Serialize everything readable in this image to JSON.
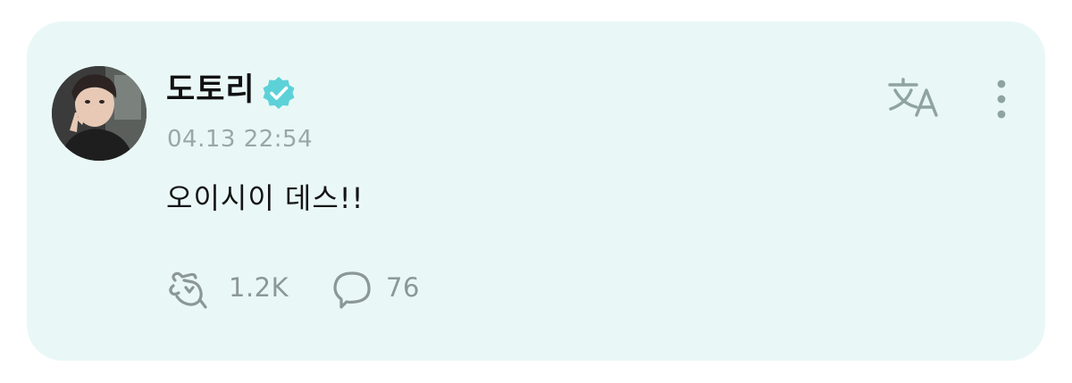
{
  "post": {
    "author": "도토리",
    "timestamp": "04.13 22:54",
    "content": "오이시이 데스!!",
    "likes": "1.2K",
    "comments": "76"
  },
  "icons": {
    "verified": "verified-badge-icon",
    "translate": "translate-icon",
    "more": "more-vertical-icon",
    "like": "cheer-hand-icon",
    "comment": "comment-bubble-icon"
  },
  "colors": {
    "card_background": "#e9f8f6",
    "accent": "#5cd2d8",
    "muted": "#8c9796"
  }
}
